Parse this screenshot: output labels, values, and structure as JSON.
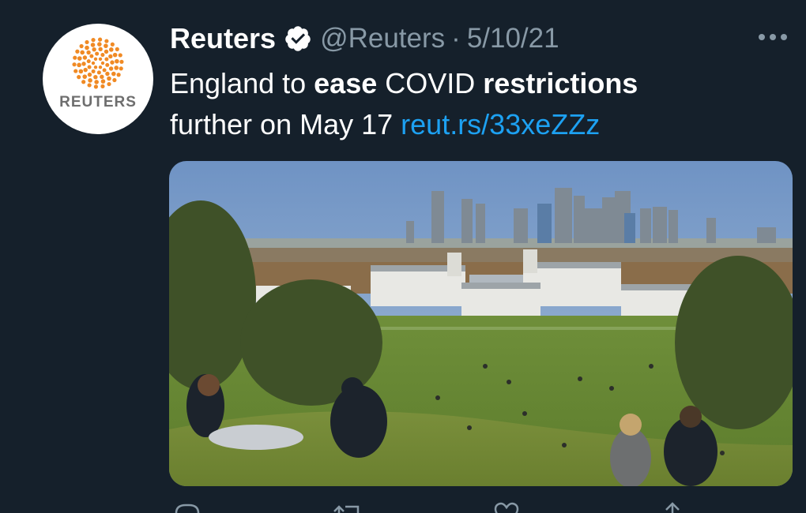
{
  "tweet": {
    "avatar_label": "REUTERS",
    "display_name": "Reuters",
    "handle": "@Reuters",
    "separator": "·",
    "date": "5/10/21",
    "text_segments": {
      "s1": "England to ",
      "s2": "ease",
      "s3": " COVID ",
      "s4": "restrictions",
      "s5": "further on May 17 ",
      "link": "reut.rs/33xeZZz"
    },
    "media": {
      "icon": "photo"
    }
  },
  "actions": [
    {
      "icon": "reply-icon"
    },
    {
      "icon": "retweet-icon"
    },
    {
      "icon": "like-icon"
    },
    {
      "icon": "share-icon"
    }
  ],
  "colors": {
    "background": "#15202b",
    "text": "#ffffff",
    "secondary": "#8899a6",
    "link": "#1da1f2",
    "brand_orange": "#f08a24"
  }
}
